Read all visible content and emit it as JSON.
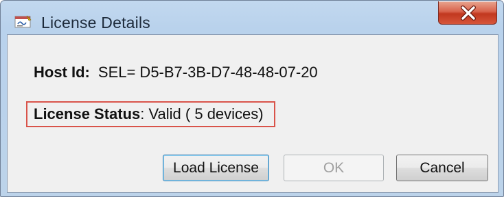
{
  "window": {
    "title": "License Details",
    "close_glyph": "x",
    "app_icon": "license-app-icon",
    "close_icon": "close-icon"
  },
  "host": {
    "label": "Host Id:",
    "value": "SEL= D5-B7-3B-D7-48-48-07-20"
  },
  "license": {
    "label": "License Status",
    "value": ": Valid ( 5 devices)"
  },
  "buttons": {
    "load_license": "Load License",
    "ok": "OK",
    "cancel": "Cancel"
  },
  "colors": {
    "highlight_border": "#d9534a",
    "close_button": "#c1381f",
    "title_bar": "#b9d2ec",
    "dialog_background": "#f0f0f0"
  }
}
